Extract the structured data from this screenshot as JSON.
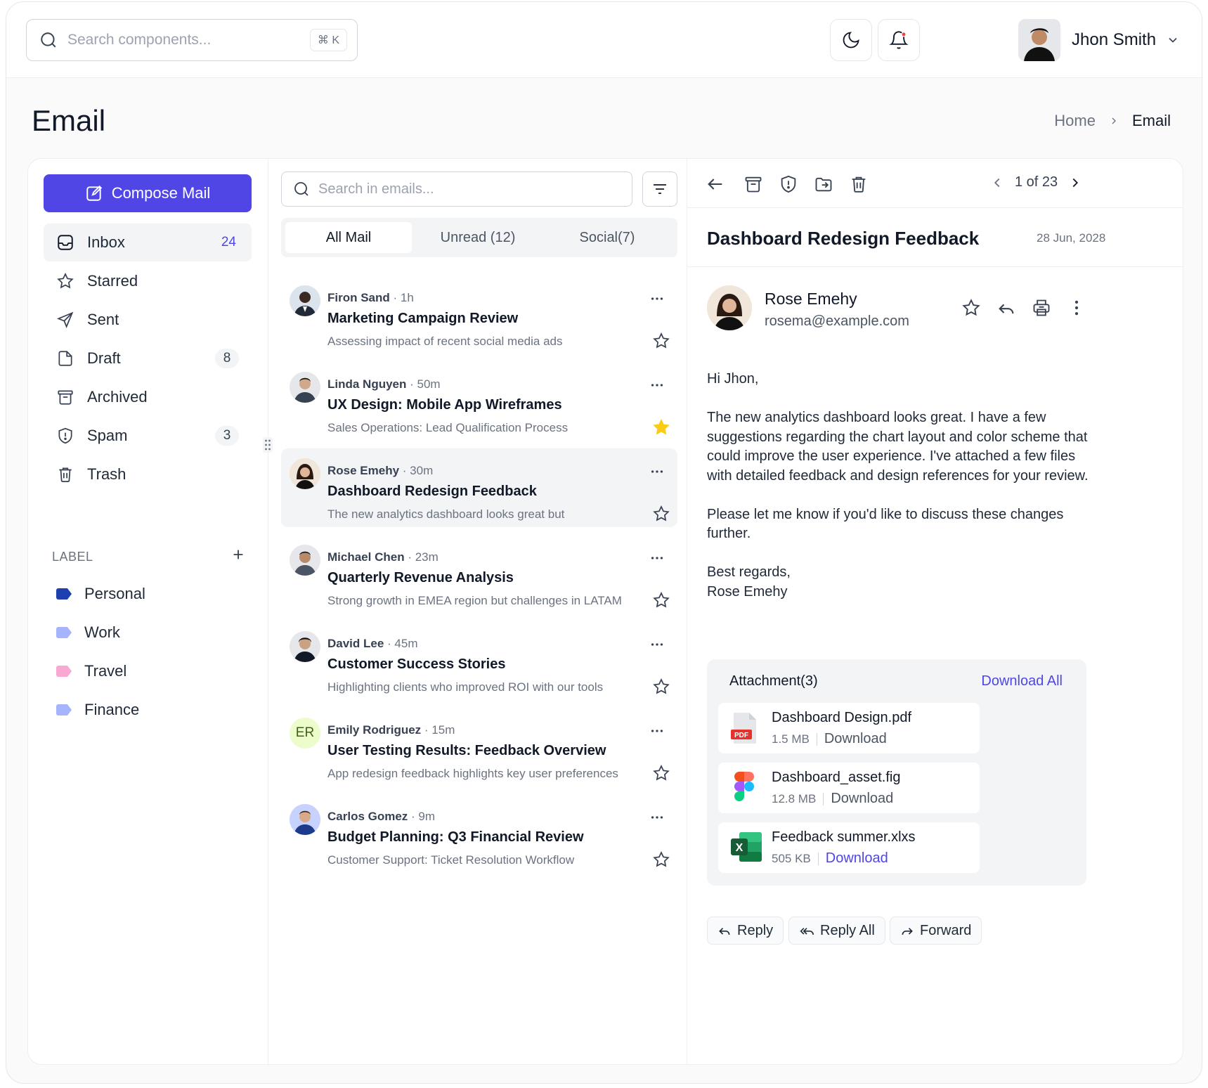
{
  "topbar": {
    "search_placeholder": "Search components...",
    "shortcut": "⌘ K",
    "user_name": "Jhon Smith"
  },
  "page": {
    "title": "Email",
    "breadcrumb": {
      "home": "Home",
      "current": "Email"
    }
  },
  "sidebar": {
    "compose_label": "Compose Mail",
    "nav": [
      {
        "label": "Inbox",
        "count": "24",
        "icon": "inbox-icon"
      },
      {
        "label": "Starred",
        "count": "",
        "icon": "star-icon"
      },
      {
        "label": "Sent",
        "count": "",
        "icon": "send-icon"
      },
      {
        "label": "Draft",
        "count": "8",
        "icon": "draft-icon"
      },
      {
        "label": "Archived",
        "count": "",
        "icon": "archive-icon"
      },
      {
        "label": "Spam",
        "count": "3",
        "icon": "spam-icon"
      },
      {
        "label": "Trash",
        "count": "",
        "icon": "trash-icon"
      }
    ],
    "labels_header": "LABEL",
    "labels": [
      {
        "label": "Personal",
        "color": "#1e40af"
      },
      {
        "label": "Work",
        "color": "#a5b4fc"
      },
      {
        "label": "Travel",
        "color": "#f9a8d4"
      },
      {
        "label": "Finance",
        "color": "#a5b4fc"
      }
    ]
  },
  "list": {
    "search_placeholder": "Search in emails...",
    "tabs": [
      "All Mail",
      "Unread (12)",
      "Social(7)"
    ],
    "mails": [
      {
        "from": "Firon Sand",
        "time": "· 1h",
        "subject": "Marketing Campaign Review",
        "preview": "Assessing impact of recent social media ads",
        "starred": false,
        "initials": ""
      },
      {
        "from": "Linda Nguyen",
        "time": "· 50m",
        "subject": "UX Design: Mobile App Wireframes",
        "preview": "Sales Operations: Lead Qualification Process",
        "starred": true,
        "initials": ""
      },
      {
        "from": "Rose Emehy",
        "time": "· 30m",
        "subject": "Dashboard Redesign Feedback",
        "preview": "The new analytics dashboard looks great but",
        "starred": false,
        "initials": ""
      },
      {
        "from": "Michael Chen",
        "time": "· 23m",
        "subject": "Quarterly Revenue Analysis",
        "preview": "Strong growth in EMEA region but challenges in LATAM",
        "starred": false,
        "initials": ""
      },
      {
        "from": "David Lee",
        "time": "· 45m",
        "subject": "Customer Success Stories",
        "preview": "Highlighting clients who improved ROI with our tools",
        "starred": false,
        "initials": ""
      },
      {
        "from": "Emily Rodriguez",
        "time": "· 15m",
        "subject": "User Testing Results: Feedback Overview",
        "preview": "App redesign feedback highlights key user preferences",
        "starred": false,
        "initials": "ER"
      },
      {
        "from": "Carlos Gomez",
        "time": "· 9m",
        "subject": "Budget Planning: Q3 Financial Review",
        "preview": "Customer Support: Ticket Resolution Workflow",
        "starred": false,
        "initials": ""
      }
    ]
  },
  "reader": {
    "pager": "1 of 23",
    "subject": "Dashboard Redesign Feedback",
    "date": "28 Jun, 2028",
    "sender_name": "Rose Emehy",
    "sender_email": "rosema@example.com",
    "body": [
      "Hi Jhon,",
      "The new analytics dashboard looks great. I have a few suggestions regarding the chart layout and color scheme that could improve the user experience. I've attached a few files with detailed feedback and design references for your review.",
      "Please let me know if you'd like to discuss these changes further.",
      "Best regards,",
      "Rose Emehy"
    ],
    "attachments_header": "Attachment(3)",
    "download_all": "Download All",
    "attachments": [
      {
        "name": "Dashboard Design.pdf",
        "size": "1.5 MB",
        "action": "Download",
        "icon": "pdf-icon",
        "badge": "PDF"
      },
      {
        "name": "Dashboard_asset.fig",
        "size": "12.8 MB",
        "action": "Download",
        "icon": "figma-icon"
      },
      {
        "name": "Feedback summer.xlxs",
        "size": "505 KB",
        "action": "Download",
        "icon": "excel-icon",
        "badge": "X"
      }
    ],
    "buttons": {
      "reply": "Reply",
      "reply_all": "Reply All",
      "forward": "Forward"
    }
  },
  "colors": {
    "accent": "#4f46e5",
    "star_filled": "#facc15",
    "notification_dot": "#ef4444"
  }
}
